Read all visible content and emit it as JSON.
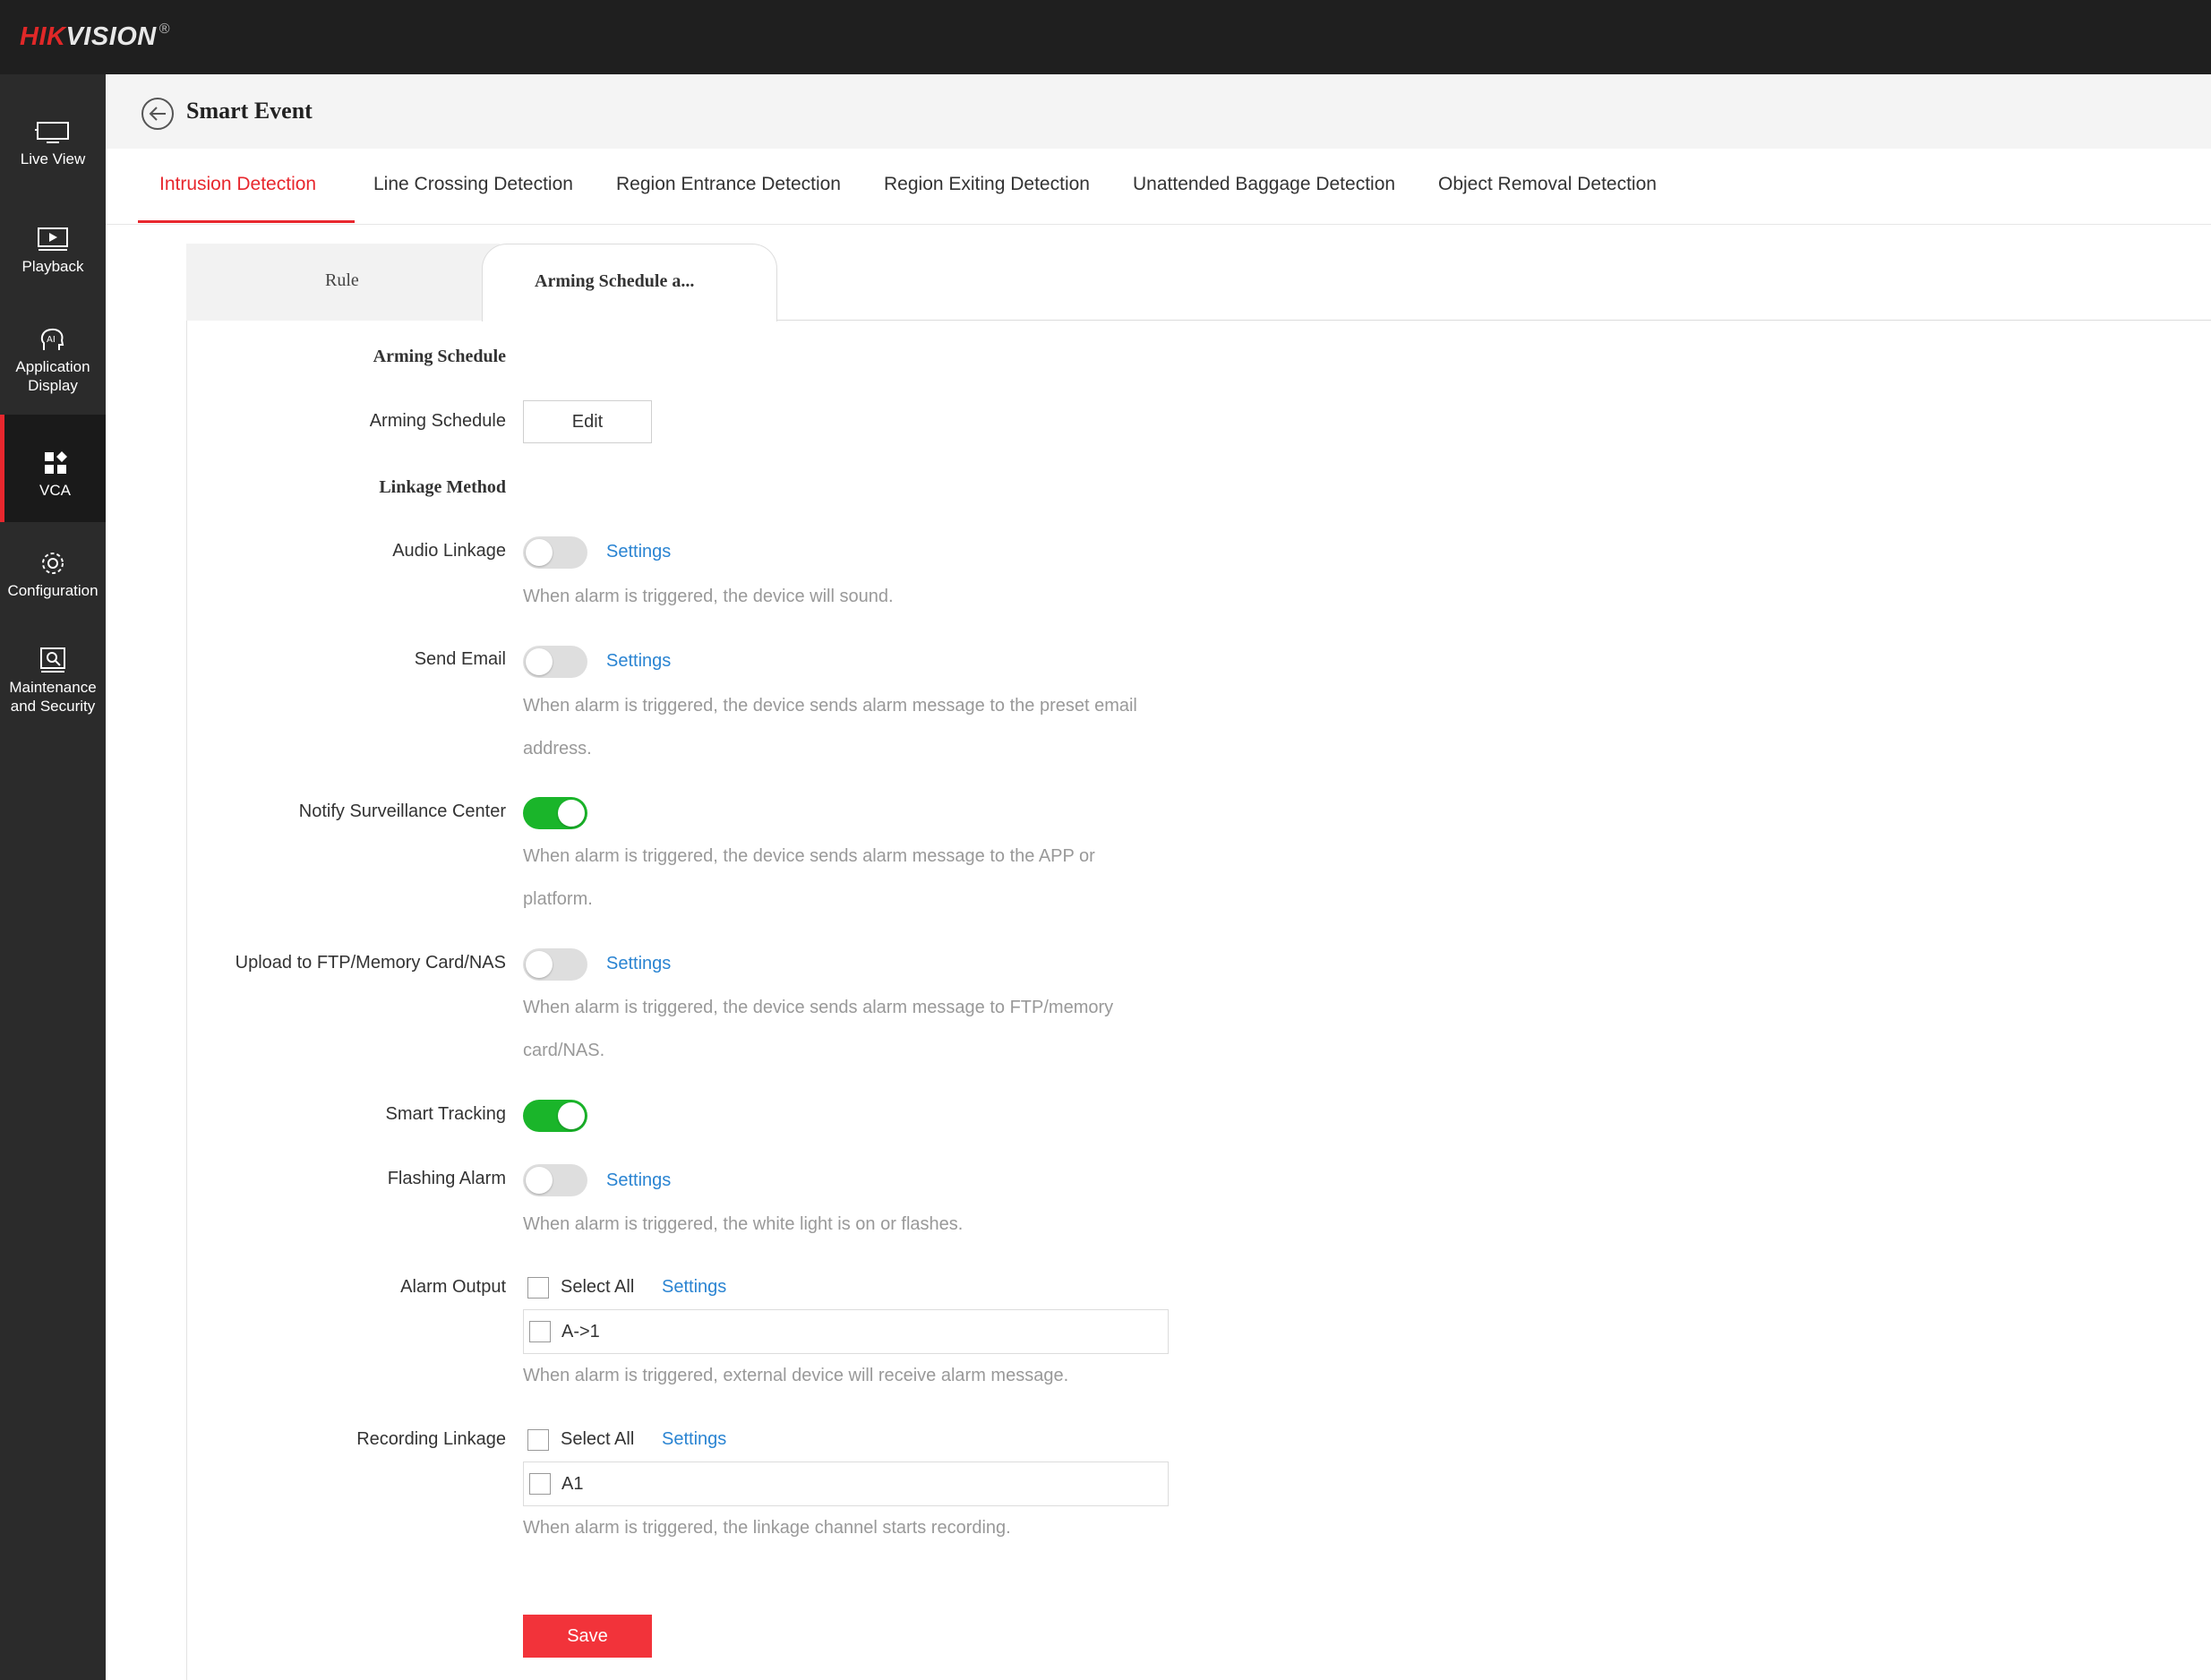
{
  "brand": {
    "logo_red": "HIK",
    "logo_white": "VISION",
    "logo_mark": "®"
  },
  "colors": {
    "accent_red": "#e8272e",
    "toggle_on": "#1ab52a",
    "link_blue": "#2a84d2",
    "save_red": "#f2333a",
    "sidebar_bg": "#2b2b2b",
    "topbar_bg": "#1f1f1f"
  },
  "sidebar": {
    "items": [
      {
        "label": "Live View",
        "icon": "monitor-icon"
      },
      {
        "label": "Playback",
        "icon": "playback-icon"
      },
      {
        "label": "Application Display",
        "icon": "ai-head-icon"
      },
      {
        "label": "VCA",
        "icon": "vca-grid-icon",
        "active": true
      },
      {
        "label": "Configuration",
        "icon": "gear-icon"
      },
      {
        "label": "Maintenance and Security",
        "icon": "maintenance-icon"
      }
    ]
  },
  "header": {
    "title": "Smart Event"
  },
  "tabs": [
    {
      "label": "Intrusion Detection",
      "active": true
    },
    {
      "label": "Line Crossing Detection"
    },
    {
      "label": "Region Entrance Detection"
    },
    {
      "label": "Region Exiting Detection"
    },
    {
      "label": "Unattended Baggage Detection"
    },
    {
      "label": "Object Removal Detection"
    }
  ],
  "subtabs": {
    "rule": "Rule",
    "arming": "Arming Schedule a..."
  },
  "form": {
    "arming_section": "Arming Schedule",
    "arming_label": "Arming Schedule",
    "edit_label": "Edit",
    "linkage_section": "Linkage Method",
    "settings_label": "Settings",
    "select_all_label": "Select All",
    "audio": {
      "label": "Audio Linkage",
      "on": false,
      "hint": "When alarm is triggered, the device will sound."
    },
    "email": {
      "label": "Send Email",
      "on": false,
      "hint": "When alarm is triggered, the device sends alarm message to the preset email address."
    },
    "notify": {
      "label": "Notify Surveillance Center",
      "on": true,
      "hint": "When alarm is triggered, the device sends alarm message to the APP or platform."
    },
    "ftp": {
      "label": "Upload to FTP/Memory Card/NAS",
      "on": false,
      "hint": "When alarm is triggered, the device sends alarm message to FTP/memory card/NAS."
    },
    "tracking": {
      "label": "Smart Tracking",
      "on": true
    },
    "flashing": {
      "label": "Flashing Alarm",
      "on": false,
      "hint": "When alarm is triggered, the white light is on or flashes."
    },
    "alarm_output": {
      "label": "Alarm Output",
      "channel": "A->1",
      "hint": "When alarm is triggered, external device will receive alarm message."
    },
    "recording": {
      "label": "Recording Linkage",
      "channel": "A1",
      "hint": "When alarm is triggered, the linkage channel starts recording."
    },
    "save_label": "Save"
  }
}
